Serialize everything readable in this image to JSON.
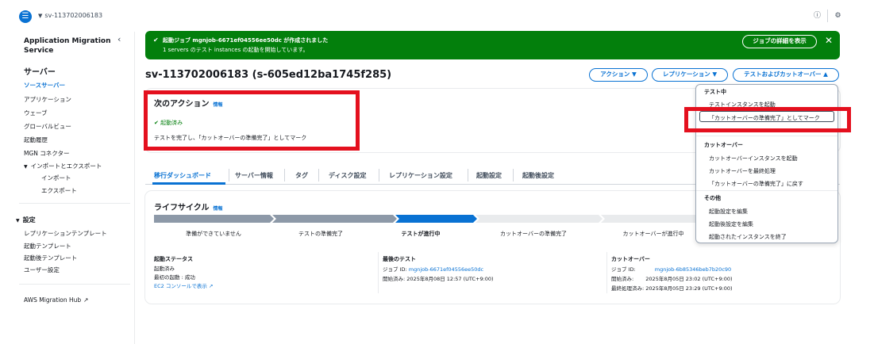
{
  "topbar": {
    "menu_icon": "menu-icon",
    "breadcrumb": "sv-113702006183"
  },
  "sidebar": {
    "title": "Application Migration Service",
    "servers_heading": "サーバー",
    "items": [
      "ソースサーバー",
      "アプリケーション",
      "ウェーブ",
      "グローバルビュー",
      "起動履歴",
      "MGN コネクター",
      "インポートとエクスポート",
      "インポート",
      "エクスポート"
    ],
    "settings_heading": "設定",
    "settings_items": [
      "レプリケーションテンプレート",
      "起動テンプレート",
      "起動後テンプレート",
      "ユーザー設定"
    ],
    "hub_link": "AWS Migration Hub"
  },
  "flash": {
    "title": "起動ジョブ mgnjob-6671ef04556ee50dc が作成されました",
    "body": "1 servers のテスト instances の起動を開始しています。",
    "details_button": "ジョブの詳細を表示"
  },
  "page": {
    "title": "sv-113702006183 (s-605ed12ba1745f285)",
    "actions": {
      "action": "アクション",
      "replication": "レプリケーション",
      "test_cutover": "テストおよびカットオーバー"
    }
  },
  "next_action": {
    "heading": "次のアクション",
    "info": "情報",
    "status": "起動済み",
    "text": "テストを完了し、「カットオーバーの準備完了」としてマーク"
  },
  "tabs": [
    "移行ダッシュボード",
    "サーバー情報",
    "タグ",
    "ディスク設定",
    "レプリケーション設定",
    "起動設定",
    "起動後設定"
  ],
  "lifecycle": {
    "heading": "ライフサイクル",
    "info": "情報",
    "stages": [
      "準備ができていません",
      "テストの準備完了",
      "テストが進行中",
      "カットオーバーの準備完了",
      "カットオーバーが進行中"
    ],
    "launch_status": {
      "heading": "起動ステータス",
      "status": "起動済み",
      "first_boot": "最初の起動 : 成功",
      "ec2_link": "EC2 コンソールで表示"
    },
    "last_test": {
      "heading": "最後のテスト",
      "job_label": "ジョブ ID:",
      "job_id": "mgnjob-6671ef04556ee50dc",
      "started_label": "開始済み:",
      "started": "2025年8月08日 12:57 (UTC+9:00)"
    },
    "cutover": {
      "heading": "カットオーバー",
      "job_label": "ジョブ ID:",
      "job_id": "mgnjob-6b85346beb7b20c90",
      "started_label": "開始済み:",
      "started": "2025年8月05日 23:02 (UTC+9:00)",
      "final_label": "最終処理済み:",
      "final": "2025年8月05日 23:29 (UTC+9:00)"
    }
  },
  "dropdown": {
    "group_testing": "テスト中",
    "testing_items": [
      "テストインスタンスを起動",
      "「カットオーバーの準備完了」としてマーク"
    ],
    "group_cutover": "カットオーバー",
    "cutover_items": [
      "カットオーバーインスタンスを起動",
      "カットオーバーを最終処理",
      "「カットオーバーの準備完了」に戻す"
    ],
    "group_other": "その他",
    "other_items": [
      "起動設定を編集",
      "起動後設定を編集",
      "起動されたインスタンスを終了"
    ]
  },
  "colors": {
    "accent": "#0972d3",
    "success": "#037f0c",
    "highlight": "#e4101e"
  }
}
